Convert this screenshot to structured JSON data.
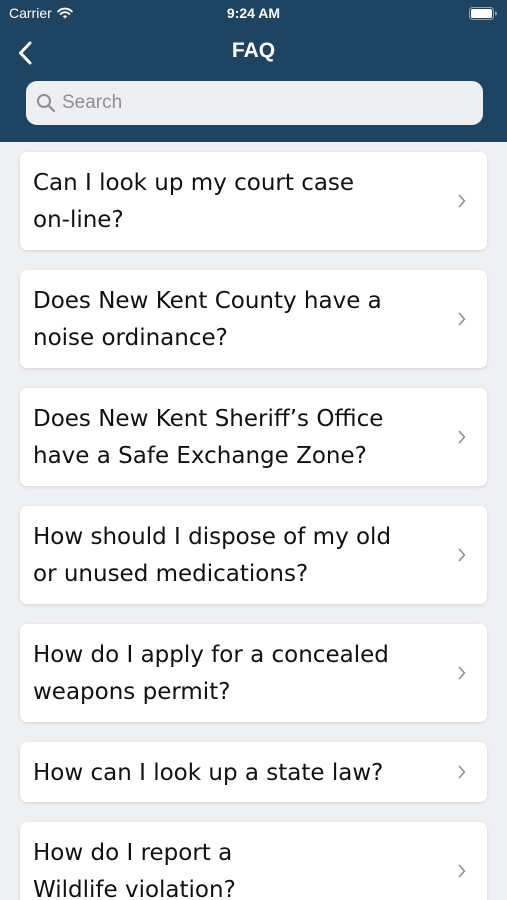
{
  "status_bar": {
    "carrier": "Carrier",
    "time": "9:24 AM"
  },
  "nav": {
    "title": "FAQ",
    "back_icon": "chevron-left-icon"
  },
  "search": {
    "placeholder": "Search",
    "value": ""
  },
  "faq_items": [
    {
      "label": "Can I look up my court case\non-line?"
    },
    {
      "label": "Does New Kent County have a\nnoise ordinance?"
    },
    {
      "label": "Does New Kent Sheriff’s Office\nhave a Safe Exchange Zone?"
    },
    {
      "label": "How should I dispose of my old\nor unused medications?"
    },
    {
      "label": "How do I apply for a concealed\nweapons permit?"
    },
    {
      "label": "How can I look up a state law?"
    },
    {
      "label": "How do I report a\nWildlife violation?"
    }
  ],
  "colors": {
    "header_bg": "#1f4461",
    "list_bg": "#eff0f2",
    "card_bg": "#ffffff",
    "chevron": "#8e8e93"
  }
}
